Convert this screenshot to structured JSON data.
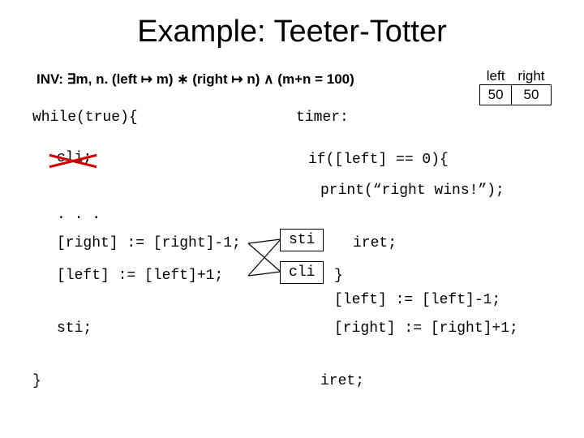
{
  "title": "Example: Teeter-Totter",
  "invariant": "INV: ∃m, n. (left ↦ m) ∗ (right ↦ n) ∧ (m+n = 100)",
  "table": {
    "left_header": "left",
    "right_header": "right",
    "left_value": "50",
    "right_value": "50"
  },
  "left_code": {
    "while": "while(true){",
    "cli": "cli;",
    "dots": ". . .",
    "right_dec": "[right] := [right]-1;",
    "left_inc": "[left]  := [left]+1;",
    "sti": "sti;",
    "brace": "}"
  },
  "right_code": {
    "timer": "timer:",
    "if_left0": "if([left] == 0){",
    "print": "print(“right wins!”);",
    "sti_box": "sti",
    "cli_box": "cli",
    "iret1": "iret;",
    "brace": "}",
    "left_dec": "[left]  := [left]-1;",
    "right_inc": "[right] := [right]+1;",
    "iret2": "iret;"
  }
}
